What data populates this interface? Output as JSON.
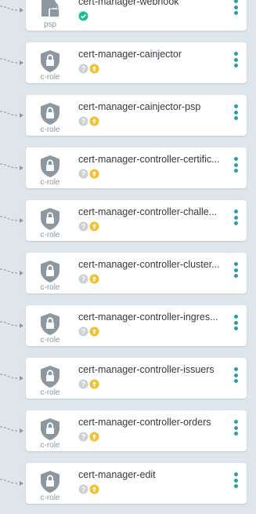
{
  "colors": {
    "background": "#dee6eb",
    "card": "#ffffff",
    "icon": "#8c979f",
    "status_ok": "#18be94",
    "status_unknown": "#cbd1d5",
    "status_outofsync": "#f4c030",
    "menu": "#2b9eab"
  },
  "resources": [
    {
      "name": "cert-manager-webhook",
      "kind": "psp",
      "icon": "psp-lock-icon",
      "health": "healthy-icon",
      "sync": null
    },
    {
      "name": "cert-manager-cainjector",
      "kind": "c-role",
      "icon": "shield-lock-icon",
      "health": "unknown-icon",
      "sync": "out-of-sync-icon"
    },
    {
      "name": "cert-manager-cainjector-psp",
      "kind": "c-role",
      "icon": "shield-lock-icon",
      "health": "unknown-icon",
      "sync": "out-of-sync-icon"
    },
    {
      "name": "cert-manager-controller-certific...",
      "kind": "c-role",
      "icon": "shield-lock-icon",
      "health": "unknown-icon",
      "sync": "out-of-sync-icon"
    },
    {
      "name": "cert-manager-controller-challe...",
      "kind": "c-role",
      "icon": "shield-lock-icon",
      "health": "unknown-icon",
      "sync": "out-of-sync-icon"
    },
    {
      "name": "cert-manager-controller-cluster...",
      "kind": "c-role",
      "icon": "shield-lock-icon",
      "health": "unknown-icon",
      "sync": "out-of-sync-icon"
    },
    {
      "name": "cert-manager-controller-ingres...",
      "kind": "c-role",
      "icon": "shield-lock-icon",
      "health": "unknown-icon",
      "sync": "out-of-sync-icon"
    },
    {
      "name": "cert-manager-controller-issuers",
      "kind": "c-role",
      "icon": "shield-lock-icon",
      "health": "unknown-icon",
      "sync": "out-of-sync-icon"
    },
    {
      "name": "cert-manager-controller-orders",
      "kind": "c-role",
      "icon": "shield-lock-icon",
      "health": "unknown-icon",
      "sync": "out-of-sync-icon"
    },
    {
      "name": "cert-manager-edit",
      "kind": "c-role",
      "icon": "shield-lock-icon",
      "health": "unknown-icon",
      "sync": "out-of-sync-icon"
    }
  ]
}
